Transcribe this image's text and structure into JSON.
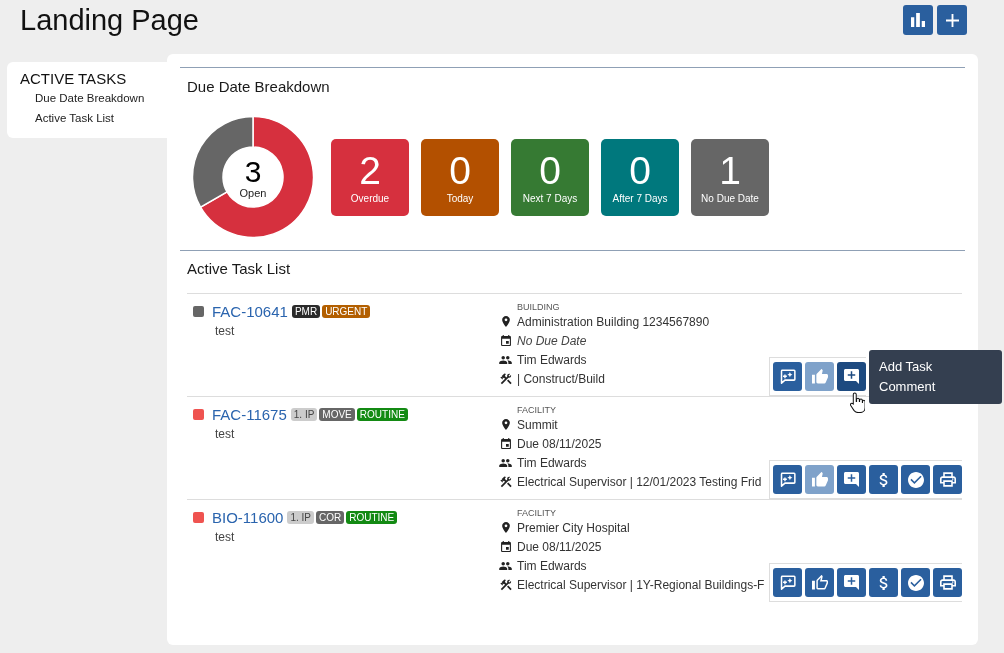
{
  "page": {
    "title": "Landing Page"
  },
  "header_actions": [
    {
      "kind": "chart"
    },
    {
      "kind": "add"
    }
  ],
  "sidebar": {
    "title": "ACTIVE TASKS",
    "items": [
      {
        "label": "Due Date Breakdown"
      },
      {
        "label": "Active Task List"
      }
    ]
  },
  "due_date_breakdown": {
    "title": "Due Date Breakdown",
    "donut": {
      "total": "3",
      "label": "Open",
      "chart_data": {
        "type": "donut",
        "values": [
          66.7,
          33.3
        ],
        "colors": [
          "#d6303e",
          "#666666"
        ]
      }
    },
    "tiles": [
      {
        "count": "2",
        "label": "Overdue",
        "color": "#d6303e"
      },
      {
        "count": "0",
        "label": "Today",
        "color": "#b35000"
      },
      {
        "count": "0",
        "label": "Next 7 Days",
        "color": "#367a33"
      },
      {
        "count": "0",
        "label": "After 7 Days",
        "color": "#00787d"
      },
      {
        "count": "1",
        "label": "No Due Date",
        "color": "#666666"
      }
    ]
  },
  "active_task_list": {
    "title": "Active Task List",
    "tasks": [
      {
        "color": "#666666",
        "task_number": "FAC-10641",
        "badges": [
          {
            "text": "PMR",
            "color": "#2b2b2b"
          },
          {
            "text": "URGENT",
            "color": "#b35f00"
          }
        ],
        "description": "test",
        "location_label": "BUILDING",
        "location": "Administration Building 1234567890",
        "due": "No Due Date",
        "due_missing": true,
        "assignee": "Tim Edwards",
        "trade": "| Construct/Build",
        "actions": [
          {
            "kind": "ai_comment",
            "disabled": false,
            "hovered": false
          },
          {
            "kind": "approve",
            "disabled": true,
            "hovered": false
          },
          {
            "kind": "comment",
            "disabled": false,
            "hovered": true,
            "tooltip": "Add Task Comment"
          }
        ]
      },
      {
        "color": "#ef5350",
        "task_number": "FAC-11675",
        "badges": [
          {
            "text": "1. IP",
            "color": "#cccccc"
          },
          {
            "text": "MOVE",
            "color": "#666666"
          },
          {
            "text": "ROUTINE",
            "color": "#138a13"
          }
        ],
        "description": "test",
        "location_label": "FACILITY",
        "location": "Summit",
        "due": "Due 08/11/2025",
        "due_missing": false,
        "assignee": "Tim Edwards",
        "trade": "Electrical Supervisor | 12/01/2023 Testing Frid",
        "actions": [
          {
            "kind": "ai_comment",
            "disabled": false,
            "hovered": false
          },
          {
            "kind": "approve",
            "disabled": true,
            "hovered": false
          },
          {
            "kind": "comment",
            "disabled": false,
            "hovered": false
          },
          {
            "kind": "cost",
            "disabled": false,
            "hovered": false
          },
          {
            "kind": "complete",
            "disabled": false,
            "hovered": false
          },
          {
            "kind": "print",
            "disabled": false,
            "hovered": false
          }
        ]
      },
      {
        "color": "#ef5350",
        "task_number": "BIO-11600",
        "badges": [
          {
            "text": "1. IP",
            "color": "#cccccc"
          },
          {
            "text": "COR",
            "color": "#666666"
          },
          {
            "text": "ROUTINE",
            "color": "#138a13"
          }
        ],
        "description": "test",
        "location_label": "FACILITY",
        "location": "Premier City Hospital",
        "due": "Due 08/11/2025",
        "due_missing": false,
        "assignee": "Tim Edwards",
        "trade": "Electrical Supervisor | 1Y-Regional Buildings-F",
        "actions": [
          {
            "kind": "ai_comment",
            "disabled": false,
            "hovered": false
          },
          {
            "kind": "approve",
            "disabled": false,
            "hovered": false
          },
          {
            "kind": "comment",
            "disabled": false,
            "hovered": false
          },
          {
            "kind": "cost",
            "disabled": false,
            "hovered": false
          },
          {
            "kind": "complete",
            "disabled": false,
            "hovered": false
          },
          {
            "kind": "print",
            "disabled": false,
            "hovered": false
          }
        ]
      }
    ]
  }
}
